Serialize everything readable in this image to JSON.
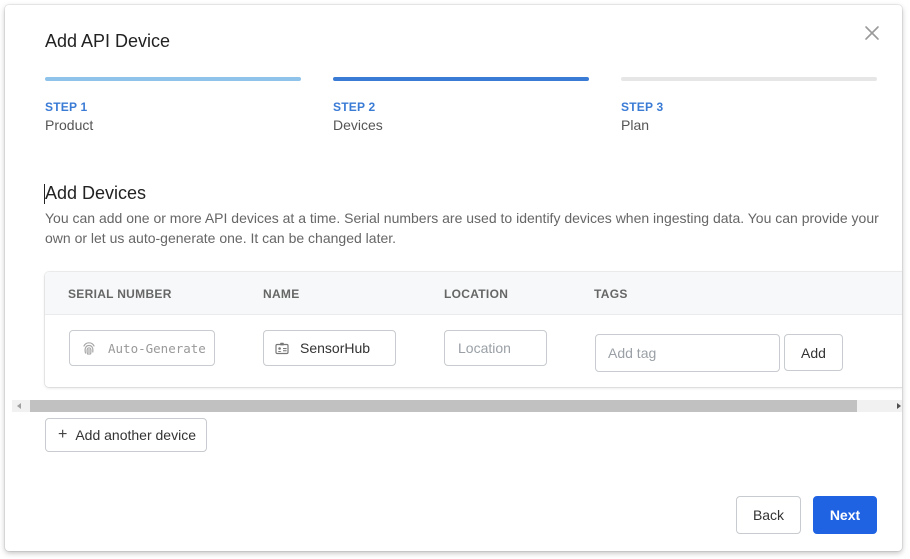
{
  "modal": {
    "title": "Add API Device"
  },
  "steps": [
    {
      "number": "STEP 1",
      "name": "Product",
      "bar_color": "#8fc3ea"
    },
    {
      "number": "STEP 2",
      "name": "Devices",
      "bar_color": "#3a7bd5"
    },
    {
      "number": "STEP 3",
      "name": "Plan",
      "bar_color": "#e6e6e6"
    }
  ],
  "section": {
    "title": "Add Devices",
    "description": "You can add one or more API devices at a time. Serial numbers are used to identify devices when ingesting data. You can provide your own or let us auto-generate one. It can be changed later."
  },
  "table": {
    "headers": [
      "SERIAL NUMBER",
      "NAME",
      "LOCATION",
      "TAGS"
    ],
    "row": {
      "serial_placeholder": "Auto-Generate",
      "serial_icon": "fingerprint-icon",
      "name_value": "SensorHub",
      "name_icon": "id-badge-icon",
      "location_placeholder": "Location",
      "tag_placeholder": "Add tag",
      "add_tag_label": "Add"
    }
  },
  "actions": {
    "add_another_label": "Add another device",
    "back_label": "Back",
    "next_label": "Next"
  },
  "colors": {
    "accent": "#3a7bd5",
    "primary_button": "#1f63e3"
  }
}
